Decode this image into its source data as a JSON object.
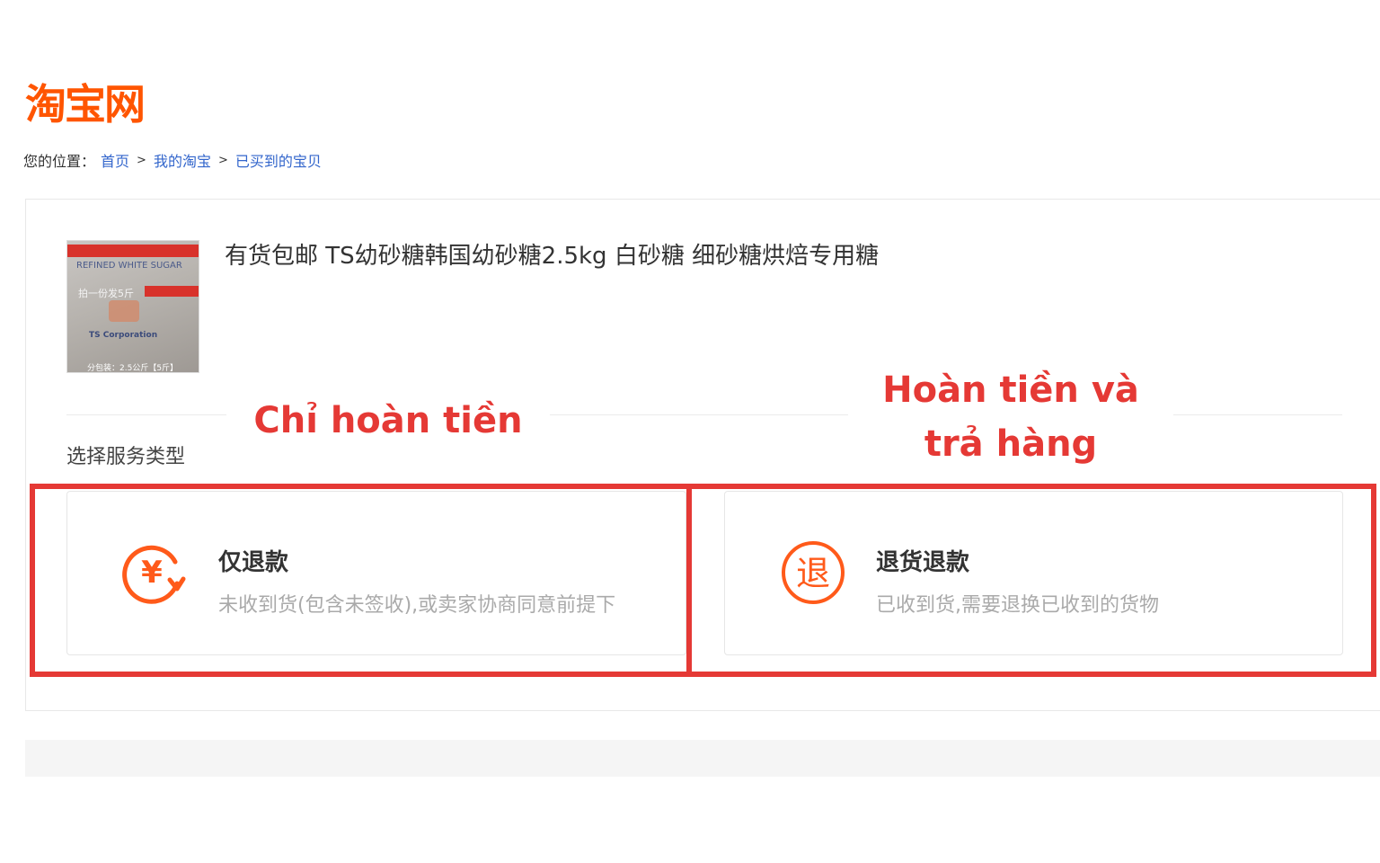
{
  "logo": {
    "text": "淘宝网"
  },
  "breadcrumb": {
    "label": "您的位置：",
    "items": [
      "首页",
      "我的淘宝",
      "已买到的宝贝"
    ],
    "separator": ">"
  },
  "product": {
    "title": "有货包邮 TS幼砂糖韩国幼砂糖2.5kg 白砂糖 细砂糖烘焙专用糖",
    "image_text": {
      "line1": "REFINED WHITE SUGAR",
      "line2": "拍一份发5斤",
      "line3": "TS Corporation",
      "line4": "分包装：2.5公斤【5斤】"
    }
  },
  "service": {
    "label": "选择服务类型",
    "options": [
      {
        "icon": "yen-refund-icon",
        "icon_text": "¥",
        "title": "仅退款",
        "desc": "未收到货(包含未签收),或卖家协商同意前提下"
      },
      {
        "icon": "return-icon",
        "icon_text": "退",
        "title": "退货退款",
        "desc": "已收到货,需要退换已收到的货物"
      }
    ]
  },
  "annotations": {
    "left": "Chỉ hoàn tiền",
    "right_line1": "Hoàn tiền và",
    "right_line2": "trả hàng"
  },
  "colors": {
    "brand": "#ff5500",
    "link": "#3366cc",
    "annotation": "#e53935",
    "icon": "#ff5a1a"
  }
}
